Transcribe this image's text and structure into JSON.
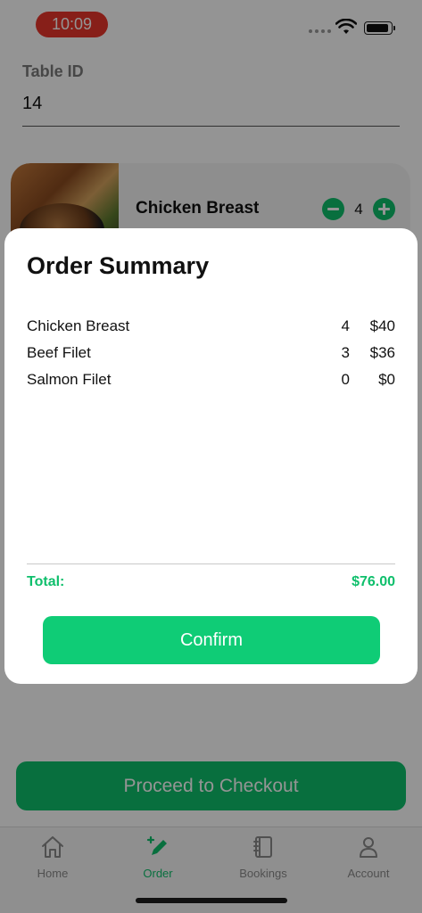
{
  "status_bar": {
    "time": "10:09"
  },
  "table": {
    "label": "Table ID",
    "value": "14"
  },
  "menu_item": {
    "name": "Chicken Breast",
    "quantity": "4"
  },
  "checkout": {
    "label": "Proceed to Checkout"
  },
  "tabs": [
    {
      "label": "Home",
      "icon": "home-icon"
    },
    {
      "label": "Order",
      "icon": "pencil-icon"
    },
    {
      "label": "Bookings",
      "icon": "book-icon"
    },
    {
      "label": "Account",
      "icon": "person-icon"
    }
  ],
  "order_summary": {
    "title": "Order Summary",
    "items": [
      {
        "name": "Chicken Breast",
        "qty": "4",
        "price": "$40"
      },
      {
        "name": "Beef Filet",
        "qty": "3",
        "price": "$36"
      },
      {
        "name": "Salmon Filet",
        "qty": "0",
        "price": "$0"
      }
    ],
    "total_label": "Total:",
    "total_value": "$76.00",
    "confirm_label": "Confirm"
  },
  "colors": {
    "accent": "#0fbf6c",
    "time_pill": "#e8362b"
  }
}
